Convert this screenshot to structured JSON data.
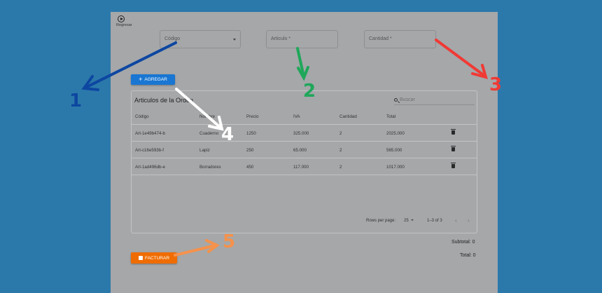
{
  "back": {
    "label": "Regresar",
    "icon": "play-circle-icon"
  },
  "form": {
    "codigo_label": "Código",
    "articulo_label": "Articulo *",
    "cantidad_label": "Cantidad *"
  },
  "add_button": {
    "label": "AGREGAR",
    "icon": "plus-icon",
    "color": "#1976d2"
  },
  "table": {
    "title": "Articulos de la Orden",
    "search_placeholder": "Buscar",
    "columns": [
      "Código",
      "Nombre",
      "Precio",
      "IVA",
      "Cantidad",
      "Total"
    ],
    "rows": [
      [
        "Art-1e49b474-b",
        "Cuaderno",
        "1250",
        "325.000",
        "2",
        "2025.000"
      ],
      [
        "Art-c16e593b-f",
        "Lapiz",
        "250",
        "65.000",
        "2",
        "565.000"
      ],
      [
        "Art-1ad496db-e",
        "Borradores",
        "450",
        "117.000",
        "2",
        "1017.000"
      ]
    ],
    "rows_per_page_label": "Rows per page:",
    "rows_per_page_value": "25",
    "range_label": "1–3 of 3"
  },
  "summary": {
    "subtotal": "Subtotal: 0",
    "total": "Total: 0"
  },
  "invoice_button": {
    "label": "FACTURAR",
    "icon": "bag-icon",
    "color": "#ef6c00"
  },
  "annotations": [
    {
      "number": "1",
      "color": "#0d47a1"
    },
    {
      "number": "2",
      "color": "#1fa75a"
    },
    {
      "number": "3",
      "color": "#f03a35"
    },
    {
      "number": "4",
      "color": "#ffffff"
    },
    {
      "number": "5",
      "color": "#f5924c"
    }
  ]
}
